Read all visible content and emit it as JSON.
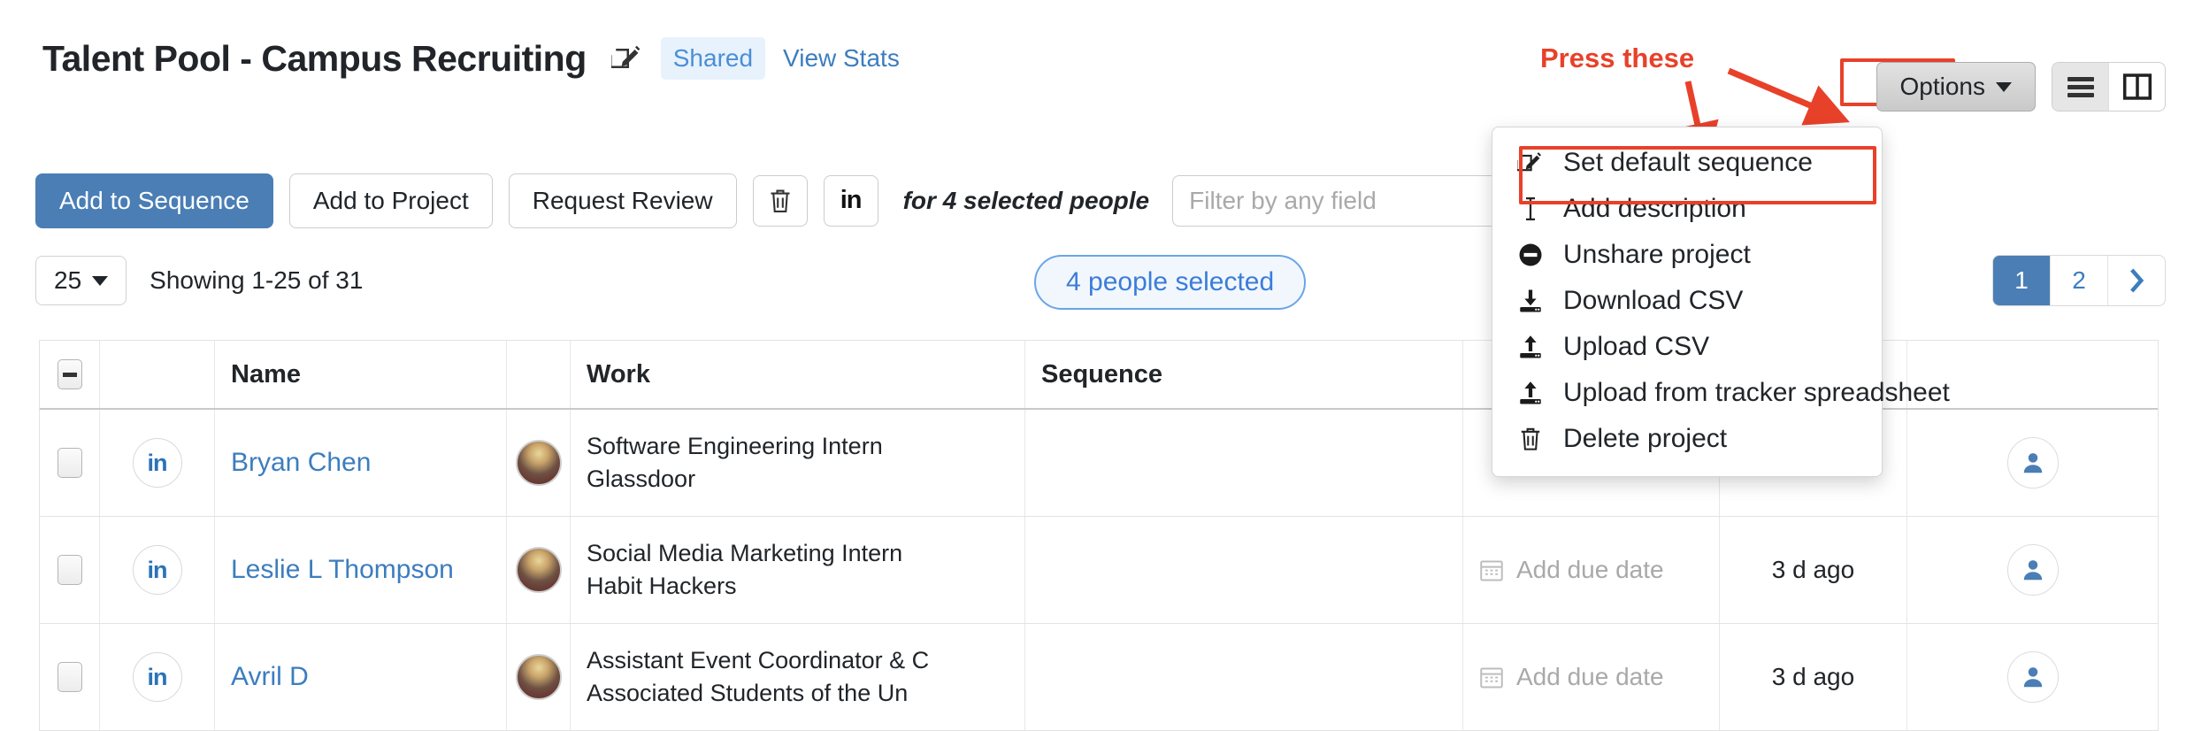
{
  "header": {
    "title": "Talent Pool - Campus Recruiting",
    "edit_icon": "pencil-square-icon",
    "shared_label": "Shared",
    "view_stats_label": "View Stats"
  },
  "annotation": {
    "text": "Press these",
    "color": "#e8412a"
  },
  "topright": {
    "options_label": "Options",
    "list_view_icon": "list-view-icon",
    "split_view_icon": "split-view-icon"
  },
  "toolbar": {
    "add_to_sequence": "Add to Sequence",
    "add_to_project": "Add to Project",
    "request_review": "Request Review",
    "delete_icon": "trash-icon",
    "linkedin_icon": "linkedin-icon",
    "linkedin_glyph": "in",
    "for_selected": "for 4 selected people",
    "filter_placeholder": "Filter by any field",
    "filter_value": ""
  },
  "row2": {
    "per_page": "25",
    "showing": "Showing 1-25 of 31",
    "selected_pill": "4 people selected",
    "pagination": [
      "1",
      "2"
    ],
    "next_icon": "chevron-right-icon"
  },
  "table": {
    "headers": {
      "select_all": "select-all-checkbox",
      "blank_li": "",
      "name": "Name",
      "blank_avatar": "",
      "work": "Work",
      "sequence": "Sequence",
      "due": "",
      "when": "",
      "owner": ""
    },
    "rows": [
      {
        "name": "Bryan Chen",
        "linkedin": "in",
        "work_title": "Software Engineering Intern",
        "work_company": "Glassdoor",
        "sequence": "",
        "due_date": "",
        "when": "",
        "owner_icon": "user-avatar-icon"
      },
      {
        "name": "Leslie L Thompson",
        "linkedin": "in",
        "work_title": "Social Media Marketing Intern",
        "work_company": "Habit Hackers",
        "sequence": "",
        "due_date": "Add due date",
        "when": "3 d ago",
        "owner_icon": "user-avatar-icon"
      },
      {
        "name": "Avril D",
        "linkedin": "in",
        "work_title": "Assistant Event Coordinator & C",
        "work_company": "Associated Students of the Un",
        "sequence": "",
        "due_date": "Add due date",
        "when": "3 d ago",
        "owner_icon": "user-avatar-icon"
      }
    ]
  },
  "dropdown": {
    "items": [
      {
        "label": "Set default sequence",
        "icon": "pencil-square-icon"
      },
      {
        "label": "Add description",
        "icon": "text-cursor-icon"
      },
      {
        "label": "Unshare project",
        "icon": "minus-circle-icon"
      },
      {
        "label": "Download CSV",
        "icon": "download-icon"
      },
      {
        "label": "Upload CSV",
        "icon": "upload-icon"
      },
      {
        "label": "Upload from tracker spreadsheet",
        "icon": "upload-icon"
      },
      {
        "label": "Delete project",
        "icon": "trash-icon"
      }
    ]
  },
  "colors": {
    "primary": "#4a7eb5",
    "link": "#3c7dbf",
    "annotation": "#e8412a",
    "shared_bg": "#e8f2fc"
  }
}
